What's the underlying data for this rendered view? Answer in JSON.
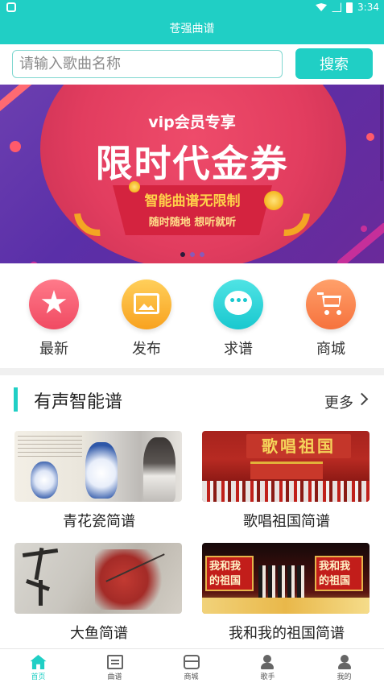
{
  "status_bar": {
    "time": "3:34"
  },
  "header": {
    "title": "苍强曲谱"
  },
  "search": {
    "placeholder": "请输入歌曲名称",
    "button_label": "搜索"
  },
  "banner": {
    "vip_text": "vip会员专享",
    "headline": "限时代金券",
    "ribbon_text": "智能曲谱无限制",
    "ribbon_sub": "随时随地 想听就听",
    "page_count": 3,
    "active_page": 0
  },
  "quick_actions": [
    {
      "label": "最新",
      "icon": "star-icon",
      "color": "#f04a62"
    },
    {
      "label": "发布",
      "icon": "image-icon",
      "color": "#f8a21f"
    },
    {
      "label": "求谱",
      "icon": "chat-bubble-icon",
      "color": "#19c8cf"
    },
    {
      "label": "商城",
      "icon": "cart-icon",
      "color": "#f6723d"
    }
  ],
  "section": {
    "title": "有声智能谱",
    "more_label": "更多"
  },
  "songs": [
    {
      "title": "青花瓷简谱",
      "thumb_text": ""
    },
    {
      "title": "歌唱祖国简谱",
      "thumb_text": "歌唱祖国"
    },
    {
      "title": "大鱼简谱",
      "thumb_text": ""
    },
    {
      "title": "我和我的祖国简谱",
      "thumb_text": "我和我的祖国"
    }
  ],
  "tabs": [
    {
      "label": "首页",
      "icon": "home-icon",
      "active": true
    },
    {
      "label": "曲谱",
      "icon": "score-icon",
      "active": false
    },
    {
      "label": "商城",
      "icon": "shop-icon",
      "active": false
    },
    {
      "label": "歌手",
      "icon": "singer-icon",
      "active": false
    },
    {
      "label": "我的",
      "icon": "profile-icon",
      "active": false
    }
  ],
  "colors": {
    "accent": "#20cfc5",
    "banner_red": "#e23d5f",
    "banner_purple": "#5a2fa8",
    "ribbon_gold": "#ffd24a"
  }
}
